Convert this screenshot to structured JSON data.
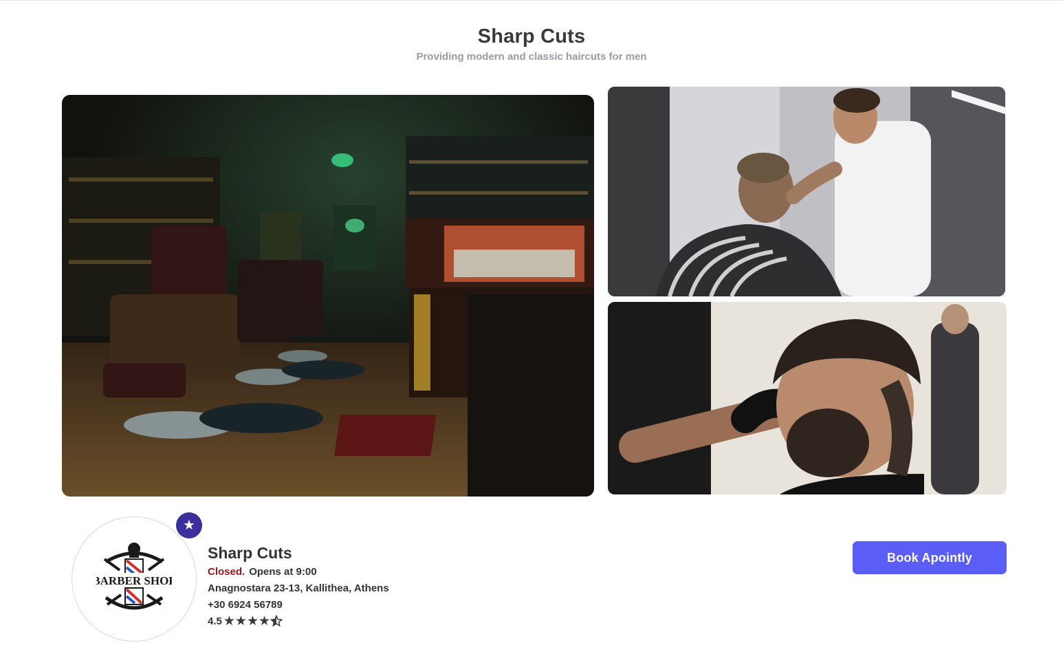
{
  "header": {
    "title": "Sharp Cuts",
    "subtitle": "Providing modern and classic haircuts for men"
  },
  "gallery": {
    "main_icon": "barbershop-interior-photo",
    "top_icon": "barber-cutting-hair-photo",
    "bottom_icon": "client-fade-haircut-photo"
  },
  "profile": {
    "logo_text": "BARBER SHOP",
    "badge_icon": "star-icon",
    "name": "Sharp Cuts",
    "status": "Closed.",
    "opens": "Opens at 9:00",
    "address": "Anagnostara 23-13, Kallithea, Athens",
    "phone": "+30 6924 56789",
    "rating": "4.5",
    "rating_value": 4.5,
    "rating_max": 5
  },
  "actions": {
    "book_label": "Book Apointly"
  },
  "colors": {
    "accent": "#5b5ef6",
    "badge": "#3b2f9e",
    "closed": "#a2131a"
  }
}
